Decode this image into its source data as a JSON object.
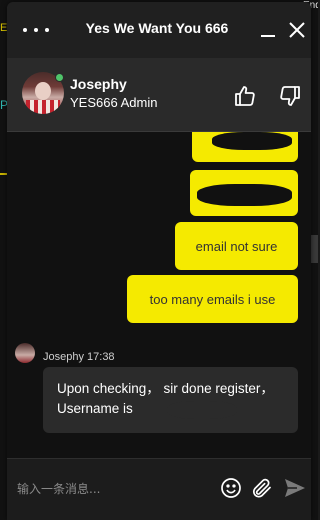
{
  "background": {
    "left_text_1": "E",
    "left_text_2": "P",
    "top_right_text": "English"
  },
  "header": {
    "title": "Yes We Want You 666"
  },
  "agent": {
    "name": "Josephy",
    "role": "YES666 Admin",
    "status_color": "#4fc46a"
  },
  "messages": {
    "outgoing": [
      {
        "text": ""
      },
      {
        "text": ""
      },
      {
        "text": "email not sure"
      },
      {
        "text": "too many emails i use"
      }
    ],
    "incoming": {
      "sender": "Josephy",
      "time": "17:38",
      "meta": "Josephy 17:38",
      "text": "Upon checking， sir done register，Username is"
    }
  },
  "composer": {
    "placeholder": "输入一条消息..."
  },
  "colors": {
    "accent": "#f5ea00",
    "header_bg": "#202020",
    "agent_bar_bg": "#2a2a2a",
    "incoming_bubble": "#2b2b2b"
  },
  "icons": [
    "more-icon",
    "minimize-icon",
    "close-icon",
    "thumbs-up-icon",
    "thumbs-down-icon",
    "emoji-icon",
    "paperclip-icon",
    "send-icon"
  ]
}
